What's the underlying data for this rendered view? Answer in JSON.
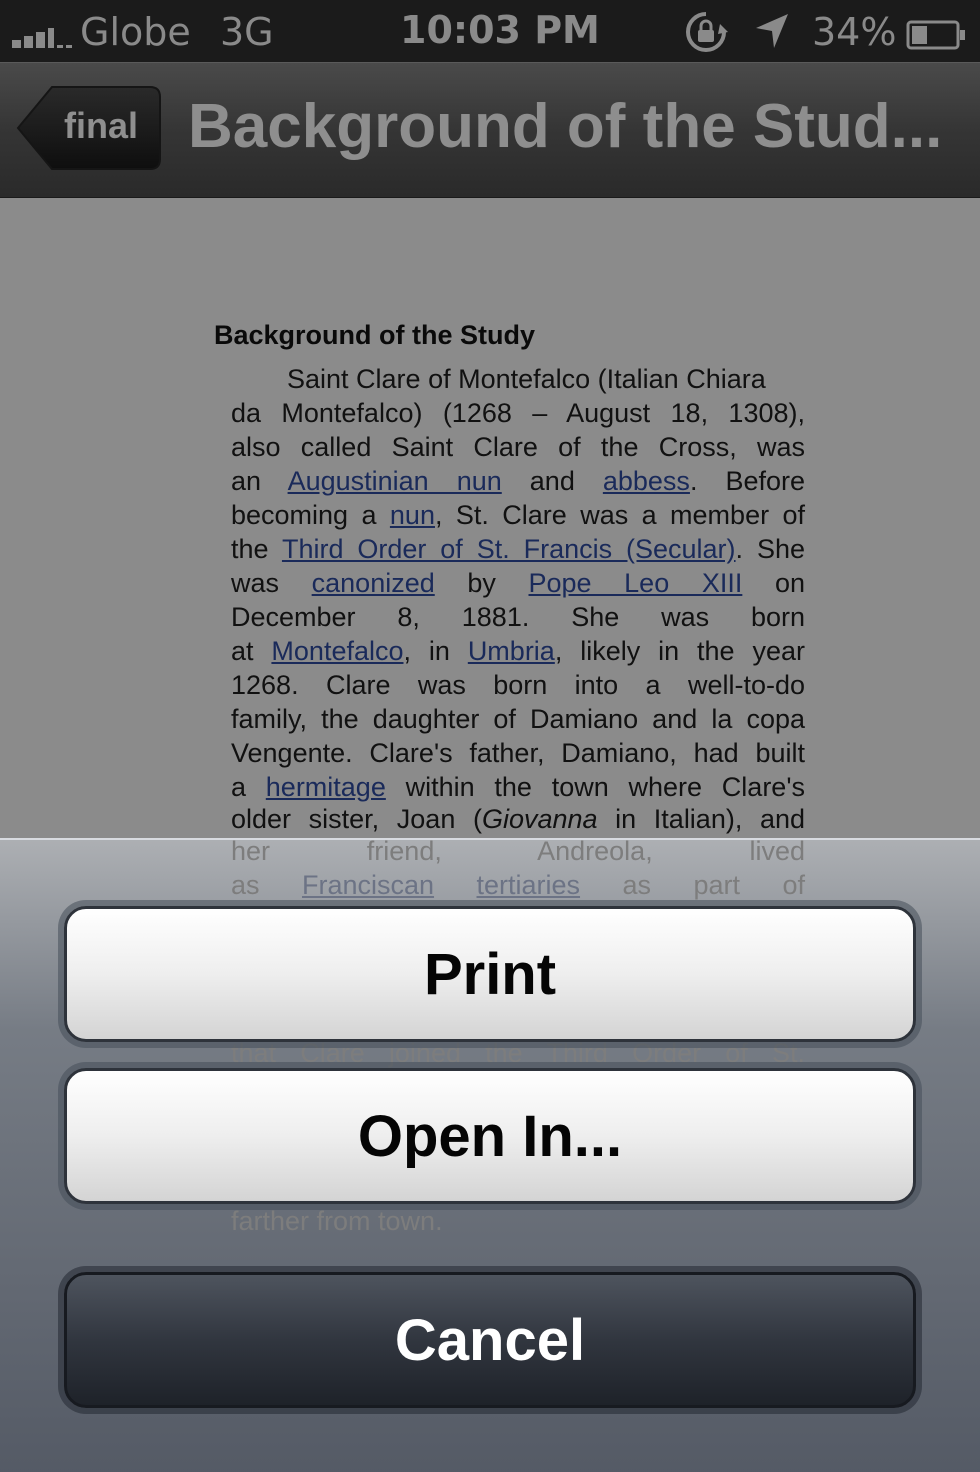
{
  "status_bar": {
    "carrier": "Globe",
    "network": "3G",
    "time": "10:03 PM",
    "battery_percent": "34%",
    "icons": [
      "signal-bars-icon",
      "rotation-lock-icon",
      "location-arrow-icon",
      "battery-icon"
    ]
  },
  "nav": {
    "back_label": "final",
    "title": "Background of the Stud..."
  },
  "document": {
    "heading": "Background of the Study",
    "lines": [
      {
        "t": "Saint Clare of Montefalco (Italian Chiara"
      },
      {
        "t": "da Montefalco) (1268 – August 18, 1308),"
      },
      {
        "t": "also called Saint Clare of the Cross, was"
      },
      {
        "t1": "an ",
        "l1": "Augustinian nun",
        "t2": " and ",
        "l2": "abbess",
        "t3": ". Before"
      },
      {
        "t1": "becoming a ",
        "l1": "nun",
        "t2": ", St. Clare was a member of"
      },
      {
        "t1": "the ",
        "l1": "Third Order of St. Francis (Secular)",
        "t2": ". She"
      },
      {
        "t1": "was ",
        "l1": "canonized",
        "t2": " by ",
        "l2": "Pope Leo XIII",
        "t3": " on"
      },
      {
        "t": "December 8, 1881. She was born"
      },
      {
        "t1": "at ",
        "l1": "Montefalco",
        "t2": ", in ",
        "l2": "Umbria",
        "t3": ", likely in the year"
      },
      {
        "t": "1268. Clare was born into a well-to-do"
      },
      {
        "t": "family, the daughter of Damiano and la copa"
      },
      {
        "t": "Vengente. Clare's father, Damiano, had built"
      },
      {
        "t1": "a ",
        "l1": "hermitage",
        "t2": " within the town where Clare's"
      },
      {
        "t1": "older sister, Joan (",
        "i1": "Giovanna",
        "t2": " in Italian), and"
      },
      {
        "t": "her friend, Andreola, lived"
      },
      {
        "t1": "as ",
        "l1": "Franciscan",
        "t2": " ",
        "l2": "tertiaries",
        "t3": " as part of"
      },
      {
        "t": "that Clare joined the Third Order of St."
      },
      {
        "t": "farther from town."
      }
    ]
  },
  "sheet": {
    "print_label": "Print",
    "open_in_label": "Open In...",
    "cancel_label": "Cancel"
  }
}
